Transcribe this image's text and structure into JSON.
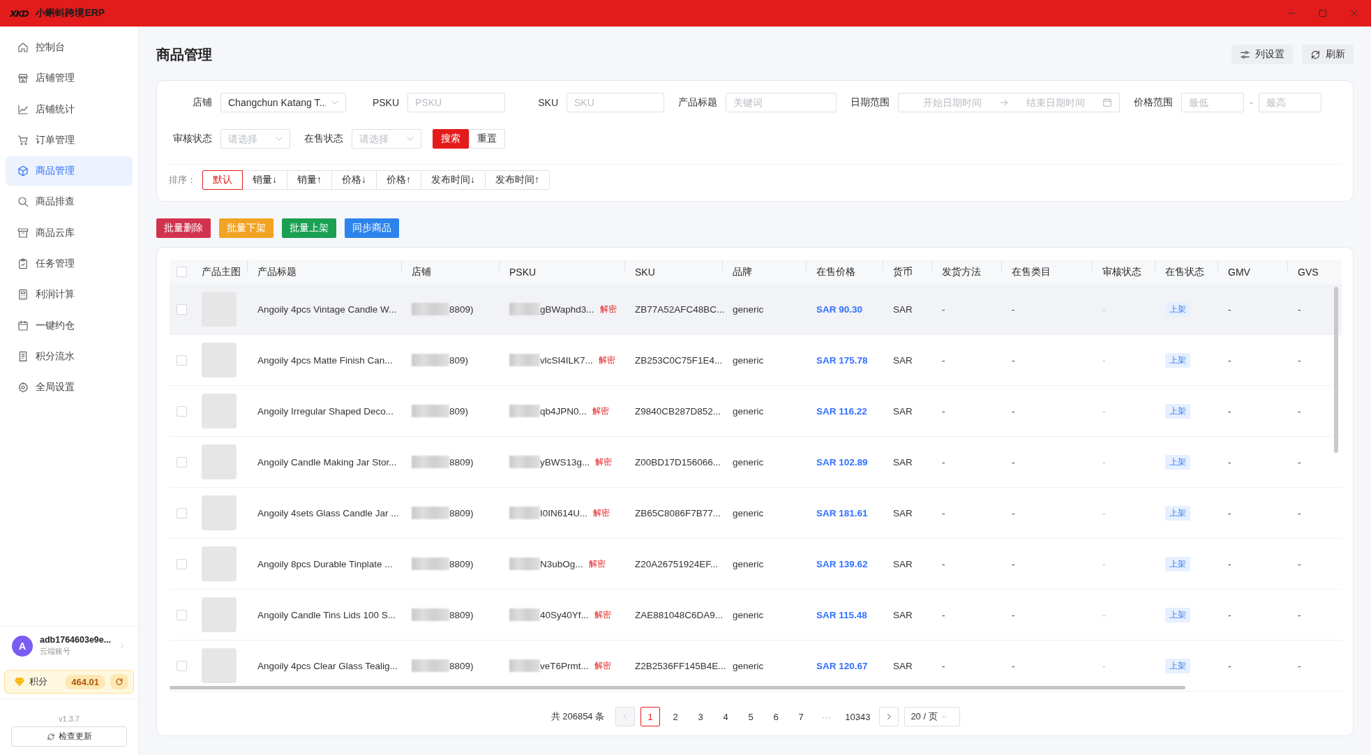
{
  "window": {
    "logo": "XKD",
    "title": "小蝌蚪跨境ERP"
  },
  "sidebar": {
    "items": [
      {
        "label": "控制台",
        "selected": false
      },
      {
        "label": "店铺管理",
        "selected": false
      },
      {
        "label": "店铺统计",
        "selected": false
      },
      {
        "label": "订单管理",
        "selected": false
      },
      {
        "label": "商品管理",
        "selected": true
      },
      {
        "label": "商品排查",
        "selected": false
      },
      {
        "label": "商品云库",
        "selected": false
      },
      {
        "label": "任务管理",
        "selected": false
      },
      {
        "label": "利润计算",
        "selected": false
      },
      {
        "label": "一键约仓",
        "selected": false
      },
      {
        "label": "积分流水",
        "selected": false
      },
      {
        "label": "全局设置",
        "selected": false
      }
    ],
    "account": {
      "initial": "A",
      "name": "adb1764603e9e...",
      "type": "云端账号"
    },
    "points": {
      "label": "积分",
      "value": "464.01"
    },
    "version": "v1.3.7",
    "update_button": "检查更新"
  },
  "page": {
    "title": "商品管理",
    "actions": [
      "列设置",
      "刷新"
    ]
  },
  "filters": {
    "rows": [
      {
        "fields": [
          {
            "label": "店铺",
            "kind": "select",
            "value": "Changchun Katang T..."
          },
          {
            "label": "PSKU",
            "kind": "input",
            "placeholder": "PSKU"
          },
          {
            "label": "SKU",
            "kind": "input",
            "placeholder": "SKU"
          },
          {
            "label": "产品标题",
            "kind": "input",
            "placeholder": "关键词"
          },
          {
            "label": "日期范围",
            "kind": "daterange",
            "start_placeholder": "开始日期时间",
            "end_placeholder": "结束日期时间"
          },
          {
            "label": "价格范围",
            "kind": "range",
            "min_placeholder": "最低",
            "separator": "-",
            "max_placeholder": "最高"
          }
        ]
      },
      {
        "fields": [
          {
            "label": "审核状态",
            "kind": "select",
            "placeholder": "请选择"
          },
          {
            "label": "在售状态",
            "kind": "select",
            "placeholder": "请选择"
          }
        ],
        "buttons": [
          {
            "label": "搜索",
            "kind": "primary"
          },
          {
            "label": "重置",
            "kind": "default"
          }
        ]
      }
    ],
    "sort": {
      "label": "排序：",
      "options": [
        {
          "label": "默认",
          "selected": true
        },
        {
          "label": "销量↓",
          "selected": false
        },
        {
          "label": "销量↑",
          "selected": false
        },
        {
          "label": "价格↓",
          "selected": false
        },
        {
          "label": "价格↑",
          "selected": false
        },
        {
          "label": "发布时间↓",
          "selected": false
        },
        {
          "label": "发布时间↑",
          "selected": false
        }
      ]
    }
  },
  "bulk_actions": [
    {
      "label": "批量删除",
      "color": "#d1334e"
    },
    {
      "label": "批量下架",
      "color": "#f2a324"
    },
    {
      "label": "批量上架",
      "color": "#1a9f53"
    },
    {
      "label": "同步商品",
      "color": "#2d83ec"
    }
  ],
  "table": {
    "select_all": {
      "checked": false
    },
    "columns": [
      "产品主图",
      "产品标题",
      "店铺",
      "PSKU",
      "SKU",
      "品牌",
      "在售价格",
      "货币",
      "发货方法",
      "在售类目",
      "审核状态",
      "在售状态",
      "GMV",
      "GVS"
    ],
    "rows": [
      {
        "checked": false,
        "hovered": true,
        "title": "Angoily 4pcs Vintage Candle W...",
        "store": "8809)",
        "psku": "gBWaphd3...",
        "decrypt": "解密",
        "sku": "ZB77A52AFC48BC...",
        "brand": "generic",
        "price": "SAR 90.30",
        "currency": "SAR",
        "shipping_method": "-",
        "category": "-",
        "review_status": "-",
        "sale_status": "上架",
        "gmv": "-",
        "gvs": "-"
      },
      {
        "checked": false,
        "hovered": false,
        "title": "Angoily 4pcs Matte Finish Can...",
        "store": "809)",
        "psku": "vlcSI4ILK7...",
        "decrypt": "解密",
        "sku": "ZB253C0C75F1E4...",
        "brand": "generic",
        "price": "SAR 175.78",
        "currency": "SAR",
        "shipping_method": "-",
        "category": "-",
        "review_status": "-",
        "sale_status": "上架",
        "gmv": "-",
        "gvs": "-"
      },
      {
        "checked": false,
        "hovered": false,
        "title": "Angoily Irregular Shaped Deco...",
        "store": "809)",
        "psku": "qb4JPN0...",
        "decrypt": "解密",
        "sku": "Z9840CB287D852...",
        "brand": "generic",
        "price": "SAR 116.22",
        "currency": "SAR",
        "shipping_method": "-",
        "category": "-",
        "review_status": "-",
        "sale_status": "上架",
        "gmv": "-",
        "gvs": "-"
      },
      {
        "checked": false,
        "hovered": false,
        "title": "Angoily Candle Making Jar Stor...",
        "store": "8809)",
        "psku": "yBWS13g...",
        "decrypt": "解密",
        "sku": "Z00BD17D156066...",
        "brand": "generic",
        "price": "SAR 102.89",
        "currency": "SAR",
        "shipping_method": "-",
        "category": "-",
        "review_status": "-",
        "sale_status": "上架",
        "gmv": "-",
        "gvs": "-"
      },
      {
        "checked": false,
        "hovered": false,
        "title": "Angoily 4sets Glass Candle Jar ...",
        "store": "8809)",
        "psku": "I0IN614U...",
        "decrypt": "解密",
        "sku": "ZB65C8086F7B77...",
        "brand": "generic",
        "price": "SAR 181.61",
        "currency": "SAR",
        "shipping_method": "-",
        "category": "-",
        "review_status": "-",
        "sale_status": "上架",
        "gmv": "-",
        "gvs": "-"
      },
      {
        "checked": false,
        "hovered": false,
        "title": "Angoily 8pcs Durable Tinplate ...",
        "store": "8809)",
        "psku": "N3ubOg...",
        "decrypt": "解密",
        "sku": "Z20A26751924EF...",
        "brand": "generic",
        "price": "SAR 139.62",
        "currency": "SAR",
        "shipping_method": "-",
        "category": "-",
        "review_status": "-",
        "sale_status": "上架",
        "gmv": "-",
        "gvs": "-"
      },
      {
        "checked": false,
        "hovered": false,
        "title": "Angoily Candle Tins Lids 100 S...",
        "store": "8809)",
        "psku": "40Sy40Yf...",
        "decrypt": "解密",
        "sku": "ZAE881048C6DA9...",
        "brand": "generic",
        "price": "SAR 115.48",
        "currency": "SAR",
        "shipping_method": "-",
        "category": "-",
        "review_status": "-",
        "sale_status": "上架",
        "gmv": "-",
        "gvs": "-"
      },
      {
        "checked": false,
        "hovered": false,
        "title": "Angoily 4pcs Clear Glass Tealig...",
        "store": "8809)",
        "psku": "veT6Prmt...",
        "decrypt": "解密",
        "sku": "Z2B2536FF145B4E...",
        "brand": "generic",
        "price": "SAR 120.67",
        "currency": "SAR",
        "shipping_method": "-",
        "category": "-",
        "review_status": "-",
        "sale_status": "上架",
        "gmv": "-",
        "gvs": "-"
      }
    ]
  },
  "pagination": {
    "total": "共 206854 条",
    "prev": {
      "disabled": true
    },
    "pages": [
      {
        "label": "1",
        "kind": "page",
        "selected": true
      },
      {
        "label": "2",
        "kind": "page",
        "selected": false
      },
      {
        "label": "3",
        "kind": "page",
        "selected": false
      },
      {
        "label": "4",
        "kind": "page",
        "selected": false
      },
      {
        "label": "5",
        "kind": "page",
        "selected": false
      },
      {
        "label": "6",
        "kind": "page",
        "selected": false
      },
      {
        "label": "7",
        "kind": "page",
        "selected": false
      },
      {
        "label": "···",
        "kind": "ellipsis",
        "selected": false
      },
      {
        "label": "10343",
        "kind": "page",
        "selected": false
      }
    ],
    "next": {
      "disabled": false
    },
    "page_size": "20 / 页"
  }
}
